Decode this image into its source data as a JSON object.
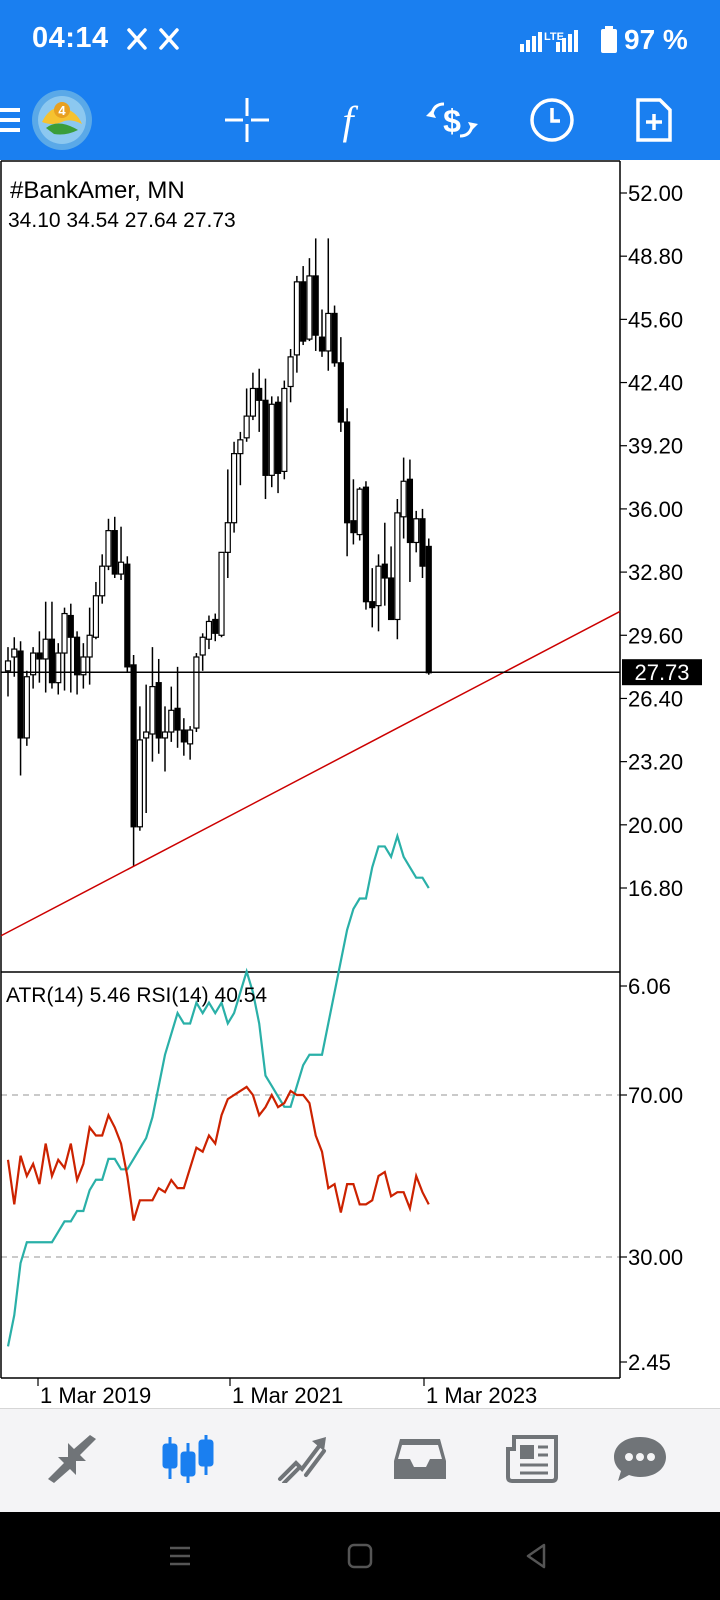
{
  "status_bar": {
    "time": "04:14",
    "battery": "97 %",
    "network": "LTE"
  },
  "toolbar": {
    "items": [
      {
        "name": "menu-button",
        "icon": "hamburger-icon"
      },
      {
        "name": "mt4-logo",
        "icon": "mt4-logo-icon"
      },
      {
        "name": "crosshair-button",
        "icon": "crosshair-icon"
      },
      {
        "name": "indicators-button",
        "icon": "function-f-icon"
      },
      {
        "name": "trade-button",
        "icon": "dollar-exchange-icon"
      },
      {
        "name": "timeframe-button",
        "icon": "clock-icon"
      },
      {
        "name": "new-order-button",
        "icon": "add-document-icon"
      }
    ]
  },
  "chart": {
    "symbol_title": "#BankAmer, MN",
    "ohlc_text": "34.10 34.54 27.64 27.73",
    "current_price": "27.73",
    "indicator_title": "ATR(14) 5.46 RSI(14) 40.54",
    "colors": {
      "candle": "#000000",
      "trendline": "#cc0000",
      "atr": "#2ab0a8",
      "rsi": "#cc2200",
      "price_tag_bg": "#000000"
    }
  },
  "chart_data": {
    "type": "candlestick",
    "timeframe": "MN",
    "price_axis_ticks": [
      "52.00",
      "48.80",
      "45.60",
      "42.40",
      "39.20",
      "36.00",
      "32.80",
      "29.60",
      "26.40",
      "23.20",
      "20.00",
      "16.80"
    ],
    "price_axis_values": [
      52.0,
      48.8,
      45.6,
      42.4,
      39.2,
      36.0,
      32.8,
      29.6,
      26.4,
      23.2,
      20.0,
      16.8
    ],
    "indicator_axis_ticks": [
      "6.06",
      "70.00",
      "30.00",
      "2.45"
    ],
    "time_axis_labels": [
      "1 Mar 2019",
      "1 Mar 2021",
      "1 Mar 2023"
    ],
    "last_candle": {
      "open": 34.1,
      "high": 34.54,
      "low": 27.64,
      "close": 27.73
    },
    "candles": [
      [
        27.8,
        29.0,
        26.5,
        28.3
      ],
      [
        28.5,
        29.5,
        27.5,
        28.9
      ],
      [
        28.8,
        29.3,
        22.5,
        24.4
      ],
      [
        24.4,
        27.8,
        24.0,
        27.5
      ],
      [
        27.6,
        29.0,
        26.9,
        28.7
      ],
      [
        28.7,
        29.8,
        27.2,
        28.4
      ],
      [
        28.4,
        31.3,
        26.7,
        29.4
      ],
      [
        29.4,
        31.3,
        26.9,
        27.2
      ],
      [
        27.2,
        29.2,
        26.6,
        28.7
      ],
      [
        28.7,
        31.0,
        26.8,
        30.7
      ],
      [
        30.6,
        31.2,
        26.7,
        29.5
      ],
      [
        29.5,
        29.8,
        26.6,
        27.6
      ],
      [
        27.6,
        29.2,
        26.9,
        28.5
      ],
      [
        28.5,
        31.0,
        27.1,
        29.6
      ],
      [
        29.5,
        32.3,
        29.4,
        31.6
      ],
      [
        31.6,
        33.7,
        31.2,
        33.1
      ],
      [
        33.1,
        35.5,
        32.9,
        34.9
      ],
      [
        34.9,
        35.6,
        32.5,
        32.7
      ],
      [
        32.7,
        35.1,
        32.4,
        33.3
      ],
      [
        33.2,
        33.6,
        27.7,
        28.0
      ],
      [
        28.1,
        28.6,
        17.9,
        19.9
      ],
      [
        19.9,
        26.0,
        19.7,
        24.3
      ],
      [
        24.4,
        27.1,
        20.6,
        24.7
      ],
      [
        24.6,
        29.0,
        23.2,
        27.0
      ],
      [
        27.2,
        28.4,
        23.6,
        24.4
      ],
      [
        24.4,
        26.0,
        22.7,
        24.7
      ],
      [
        24.7,
        27.0,
        24.2,
        25.8
      ],
      [
        25.9,
        28.0,
        23.9,
        24.8
      ],
      [
        24.8,
        25.4,
        23.5,
        24.2
      ],
      [
        24.1,
        25.0,
        23.3,
        24.8
      ],
      [
        24.9,
        28.7,
        24.7,
        28.5
      ],
      [
        28.6,
        29.7,
        27.8,
        29.5
      ],
      [
        29.4,
        30.6,
        28.9,
        30.3
      ],
      [
        30.4,
        30.7,
        29.3,
        29.7
      ],
      [
        29.6,
        33.8,
        29.5,
        33.8
      ],
      [
        33.8,
        38.0,
        32.5,
        35.3
      ],
      [
        35.3,
        39.4,
        34.8,
        38.8
      ],
      [
        38.8,
        39.9,
        37.2,
        39.5
      ],
      [
        39.6,
        42.1,
        39.4,
        40.7
      ],
      [
        40.7,
        42.9,
        40.5,
        42.1
      ],
      [
        42.1,
        43.1,
        39.9,
        41.5
      ],
      [
        41.5,
        42.6,
        36.5,
        37.7
      ],
      [
        37.7,
        41.7,
        37.1,
        41.3
      ],
      [
        41.4,
        41.7,
        36.8,
        37.8
      ],
      [
        37.9,
        42.5,
        37.5,
        42.1
      ],
      [
        42.2,
        44.1,
        41.4,
        43.7
      ],
      [
        43.8,
        47.8,
        42.9,
        47.5
      ],
      [
        47.5,
        48.3,
        44.3,
        44.5
      ],
      [
        44.6,
        48.7,
        44.5,
        47.8
      ],
      [
        47.8,
        49.7,
        44.0,
        44.8
      ],
      [
        44.7,
        46.1,
        43.7,
        44.0
      ],
      [
        44.0,
        49.7,
        43.0,
        45.9
      ],
      [
        45.9,
        46.3,
        43.2,
        43.4
      ],
      [
        43.4,
        44.7,
        39.9,
        40.4
      ],
      [
        40.4,
        41.1,
        33.6,
        35.3
      ],
      [
        35.4,
        37.5,
        34.2,
        34.8
      ],
      [
        34.7,
        37.1,
        34.4,
        37.0
      ],
      [
        37.1,
        37.4,
        30.9,
        31.3
      ],
      [
        31.3,
        33.0,
        30.0,
        31.0
      ],
      [
        31.1,
        33.7,
        29.8,
        33.1
      ],
      [
        33.2,
        35.3,
        31.1,
        32.5
      ],
      [
        32.5,
        34.1,
        30.4,
        30.4
      ],
      [
        30.4,
        36.5,
        29.4,
        35.8
      ],
      [
        35.6,
        38.6,
        34.5,
        37.4
      ],
      [
        37.5,
        38.5,
        32.3,
        34.3
      ],
      [
        34.3,
        35.9,
        33.8,
        35.5
      ],
      [
        35.5,
        36.0,
        32.5,
        33.1
      ],
      [
        34.1,
        34.5,
        27.6,
        27.7
      ]
    ],
    "trendline": {
      "from": [
        20,
        17.9
      ],
      "to": [
        71,
        26.4
      ],
      "description": "rising support line"
    },
    "atr": [
      2.6,
      2.9,
      3.4,
      3.6,
      3.6,
      3.6,
      3.6,
      3.6,
      3.7,
      3.8,
      3.8,
      3.9,
      3.9,
      4.1,
      4.2,
      4.2,
      4.4,
      4.4,
      4.3,
      4.3,
      4.4,
      4.5,
      4.6,
      4.8,
      5.1,
      5.4,
      5.6,
      5.8,
      5.7,
      5.7,
      5.9,
      5.8,
      5.9,
      5.8,
      5.9,
      5.7,
      5.8,
      6.0,
      6.2,
      6.0,
      5.7,
      5.2,
      5.1,
      5.0,
      4.9,
      4.9,
      5.1,
      5.3,
      5.4,
      5.4,
      5.4,
      5.7,
      6.0,
      6.3,
      6.6,
      6.8,
      6.9,
      6.9,
      7.2,
      7.4,
      7.4,
      7.3,
      7.5,
      7.3,
      7.2,
      7.1,
      7.1,
      7.0
    ],
    "rsi": [
      54,
      43,
      55,
      50,
      53,
      48,
      58,
      50,
      54,
      52,
      58,
      49,
      53,
      62,
      60,
      60,
      65,
      62,
      58,
      50,
      39,
      44,
      44,
      44,
      47,
      46,
      49,
      47,
      47,
      52,
      57,
      56,
      60,
      58,
      65,
      69,
      70,
      71,
      72,
      70,
      65,
      67,
      70,
      67,
      68,
      71,
      70,
      70,
      68,
      60,
      56,
      47,
      48,
      41,
      48,
      48,
      43,
      43,
      44,
      50,
      51,
      45,
      46,
      46,
      42,
      50,
      46,
      43
    ]
  },
  "bottom_nav": {
    "items": [
      {
        "name": "nav-quotes",
        "icon": "quotes-arrows-icon",
        "active": false
      },
      {
        "name": "nav-chart",
        "icon": "candlestick-chart-icon",
        "active": true
      },
      {
        "name": "nav-trade",
        "icon": "trade-trend-icon",
        "active": false
      },
      {
        "name": "nav-history",
        "icon": "inbox-history-icon",
        "active": false
      },
      {
        "name": "nav-news",
        "icon": "newspaper-icon",
        "active": false
      },
      {
        "name": "nav-messages",
        "icon": "chat-bubble-icon",
        "active": false
      }
    ]
  }
}
